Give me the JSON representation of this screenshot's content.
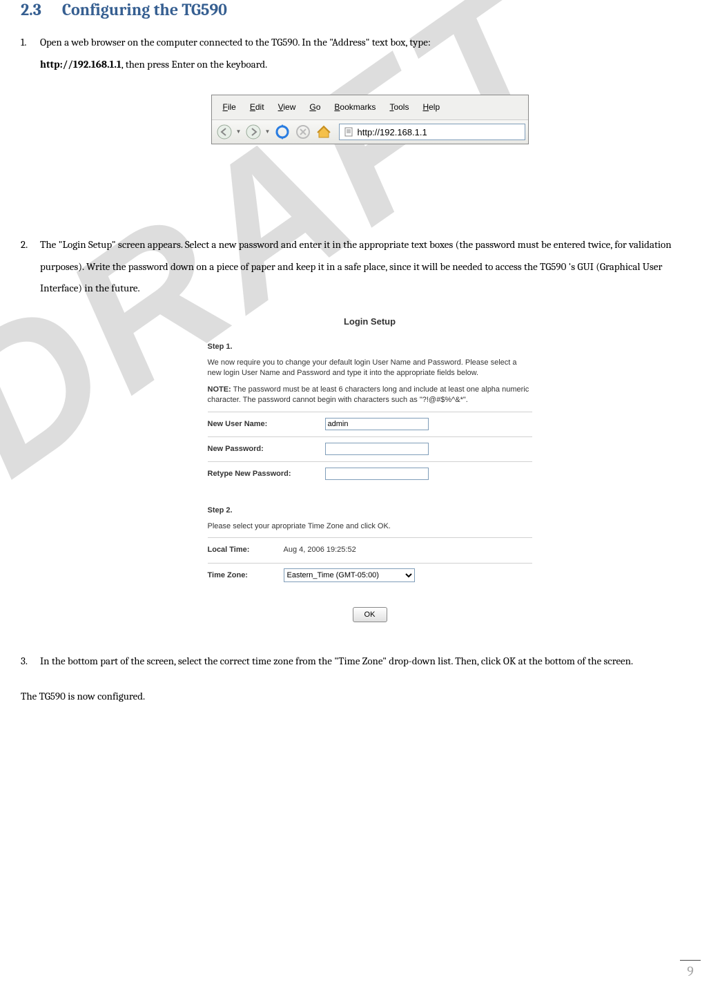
{
  "watermark": "DRAFT",
  "heading": {
    "number": "2.3",
    "title": "Configuring the TG590"
  },
  "step1": {
    "index": "1.",
    "text_a": "Open a web browser on the computer connected to the TG590. In the \"Address\" text box, type:",
    "text_b": "http://192.168.1.1",
    "text_c": ", then press Enter on the keyboard."
  },
  "browser": {
    "menu": {
      "file": "File",
      "edit": "Edit",
      "view": "View",
      "go": "Go",
      "bookmarks": "Bookmarks",
      "tools": "Tools",
      "help": "Help"
    },
    "address": "http://192.168.1.1"
  },
  "step2": {
    "index": "2.",
    "text": "The \"Login Setup\" screen appears. Select a new password and enter it in the appropriate text boxes (the password must be entered twice, for validation purposes). Write the password down on a piece of paper and keep it in a safe place, since it will be needed to access the TG590 's GUI (Graphical User Interface) in the future."
  },
  "login": {
    "title": "Login Setup",
    "step1_label": "Step 1.",
    "intro": "We now require you to change your default login User Name and Password. Please select a new login User Name and Password and type it into the appropriate fields below.",
    "note_label": "NOTE:",
    "note_text": " The password must be at least 6 characters long and include at least one alpha numeric character. The password cannot begin with characters such as \"?!@#$%^&*\".",
    "new_user_label": "New User Name:",
    "new_user_value": "admin",
    "new_pass_label": "New Password:",
    "retype_label": "Retype New Password:",
    "step2_label": "Step 2.",
    "step2_text": "Please select your apropriate Time Zone and click OK.",
    "local_time_label": "Local Time:",
    "local_time_value": "Aug 4, 2006 19:25:52",
    "timezone_label": "Time Zone:",
    "timezone_value": "Eastern_Time (GMT-05:00)",
    "ok_label": "OK"
  },
  "step3": {
    "index": "3.",
    "text": "In the bottom part of the screen, select the correct time zone from the \"Time Zone\" drop-down list.  Then, click OK at the bottom of the screen."
  },
  "final": "The TG590 is now configured.",
  "page_number": "9"
}
